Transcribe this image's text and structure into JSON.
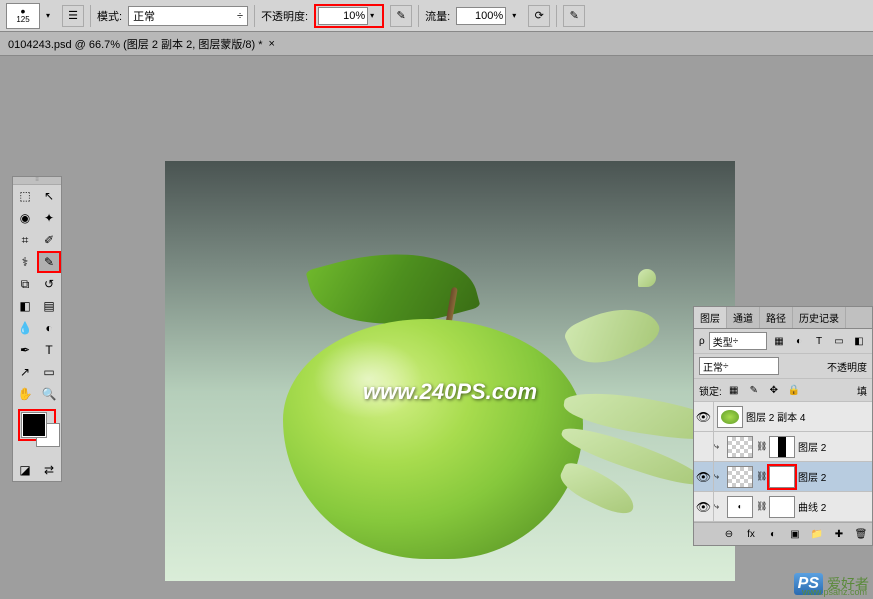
{
  "options": {
    "brush_size": "125",
    "mode_label": "模式:",
    "mode_value": "正常",
    "opacity_label": "不透明度:",
    "opacity_value": "10%",
    "flow_label": "流量:",
    "flow_value": "100%"
  },
  "tab": {
    "title": "0104243.psd @ 66.7% (图层 2 副本 2, 图层蒙版/8) *",
    "close": "×"
  },
  "tools": {
    "items": [
      "▭",
      "↖",
      "◉",
      "▨",
      "⌐",
      "✦",
      "⬔",
      "✎",
      "⧉",
      "✂",
      "⟐",
      "◐",
      "✎",
      "T",
      "↘",
      "⬡",
      "✋",
      "⌕",
      "",
      "⇄"
    ]
  },
  "colors": {
    "fg": "#000000",
    "bg": "#ffffff"
  },
  "canvas": {
    "watermark": "www.240PS.com"
  },
  "layers_panel": {
    "tabs": [
      "图层",
      "通道",
      "路径",
      "历史记录"
    ],
    "kind_label": "类型",
    "filter_icons": [
      "▦",
      "◐",
      "T",
      "▭",
      "◧"
    ],
    "blend_mode": "正常",
    "opacity_label": "不透明度",
    "lock_label": "锁定:",
    "fill_label": "填",
    "lock_icons": [
      "▦",
      "✎",
      "✥",
      "🔒"
    ],
    "layers": [
      {
        "name": "图层 2 副本 4",
        "visible": true,
        "thumb": "apple"
      },
      {
        "name": "图层 2",
        "visible": false,
        "thumb": "checker",
        "mask": "bar"
      },
      {
        "name": "图层 2",
        "visible": true,
        "thumb": "checker",
        "mask": "white",
        "selected": true,
        "highlight_mask": true
      },
      {
        "name": "曲线 2",
        "visible": true,
        "thumb": "adj",
        "mask": "white"
      }
    ],
    "footer_icons": [
      "⊖",
      "fx",
      "◐",
      "▣",
      "📁",
      "✚",
      "🗑"
    ]
  },
  "watermark": {
    "badge": "PS",
    "text": "爱好者",
    "url": "www.psahz.com"
  }
}
